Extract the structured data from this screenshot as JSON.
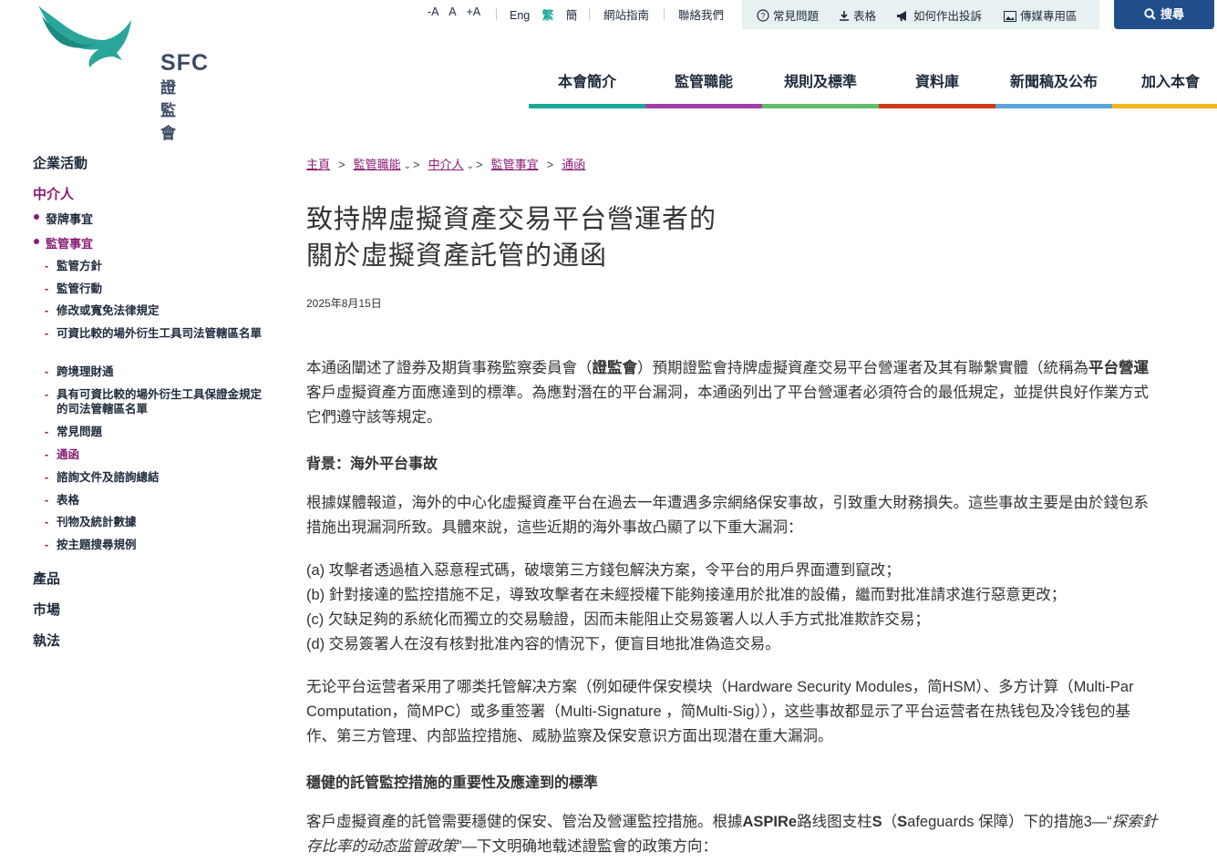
{
  "brand": {
    "logo_en": "SFC",
    "logo_zh": "證監會",
    "colors": {
      "primary": "#1f4e8a",
      "accent": "#8a1a73",
      "logo": "#2aa59a"
    }
  },
  "utility": {
    "font_small": "-A",
    "font_medium": "A",
    "font_large": "+A",
    "lang_en": "Eng",
    "lang_tc": "繁",
    "lang_sc": "簡",
    "sitemap": "網站指南",
    "contact": "聯絡我們",
    "faq": "常見問題",
    "forms": "表格",
    "complaint": "如何作出投訴",
    "media": "傳媒專用區",
    "search": "搜尋"
  },
  "nav": {
    "items": [
      {
        "label": "本會簡介",
        "color": "#1aa89c"
      },
      {
        "label": "監管職能",
        "color": "#a13fa7"
      },
      {
        "label": "規則及標準",
        "color": "#5fbe6c"
      },
      {
        "label": "資料庫",
        "color": "#cf3a17"
      },
      {
        "label": "新聞稿及公布",
        "color": "#5aa6d9"
      },
      {
        "label": "加入本會",
        "color": "#f5b51b"
      }
    ]
  },
  "sidebar": {
    "corporate": "企業活動",
    "intermediaries": "中介人",
    "licensing": "發牌事宜",
    "supervision": "監管事宜",
    "sub": [
      "監管方針",
      "監管行動",
      "修改或寬免法律規定",
      "可資比較的場外衍生工具司法管轄區名單",
      "跨境理財通",
      "具有可資比較的場外衍生工具保證金規定的司法管轄區名單",
      "常見問題",
      "通函",
      "諮詢文件及諮詢總結",
      "表格",
      "刊物及統計數據",
      "按主題搜尋規例"
    ],
    "products": "產品",
    "markets": "市場",
    "enforcement": "執法"
  },
  "breadcrumb": {
    "home": "主頁",
    "regulatory": "監管職能",
    "intermediaries": "中介人",
    "supervision": "監管事宜",
    "circulars": "通函"
  },
  "article": {
    "title_line1": "致持牌虛擬資產交易平台營運者的",
    "title_line2": "關於虛擬資產託管的通函",
    "date": "2025年8月15日",
    "p1_l1_a": "本通函闡述了證券及期貨事務監察委員會（",
    "p1_l1_b": "證監會",
    "p1_l1_c": "）預期證監會持牌虛擬資產交易平台營運者及其有聯繫實體（統稱為",
    "p1_l1_d": "平台營運",
    "p1_l2": "客戶虛擬資產方面應達到的標準。為應對潛在的平台漏洞，本通函列出了平台營運者必須符合的最低規定，並提供良好作業方式",
    "p1_l3": "它們遵守該等規定。",
    "h1": "背景：海外平台事故",
    "p2_l1": "根據媒體報道，海外的中心化虛擬資產平台在過去一年遭遇多宗網絡保安事故，引致重大財務損失。這些事故主要是由於錢包系",
    "p2_l2": "措施出現漏洞所致。具體來說，這些近期的海外事故凸顯了以下重大漏洞：",
    "list_a": "(a) 攻擊者透過植入惡意程式碼，破壞第三方錢包解決方案，令平台的用戶界面遭到竄改；",
    "list_b": "(b) 針對接達的監控措施不足，導致攻擊者在未經授權下能夠接達用於批准的設備，繼而對批准請求進行惡意更改；",
    "list_c": "(c) 欠缺足夠的系統化而獨立的交易驗證，因而未能阻止交易簽署人以人手方式批准欺詐交易；",
    "list_d": "(d) 交易簽署人在沒有核對批准內容的情況下，便盲目地批准偽造交易。",
    "p3_l1": "无论平台运营者采用了哪类托管解决方案（例如硬件保安模块（Hardware Security Modules，简HSM）、多方计算（Multi-Par",
    "p3_l2": "Computation，简MPC）或多重签署（Multi-Signature ，简Multi-Sig）），这些事故都显示了平台运营者在热钱包及冷钱包的基",
    "p3_l3": "作、第三方管理、内部监控措施、威胁监察及保安意识方面出现潜在重大漏洞。",
    "h2": "穩健的託管監控措施的重要性及應達到的標準",
    "p4_l1_a": "客戶虛擬資產的託管需要穩健的保安、管治及營運監控措施。根據",
    "p4_l1_b": "ASPIRe",
    "p4_l1_c": "路线图支柱",
    "p4_l1_d": "S",
    "p4_l1_e": "（",
    "p4_l1_f": "S",
    "p4_l1_g": "afeguards 保障）下的措施3—“",
    "p4_l1_h": "探索針",
    "p4_l2_a": "存比率的动态监管政策",
    "p4_l2_b": "”—下文明确地载述證監會的政策方向："
  }
}
